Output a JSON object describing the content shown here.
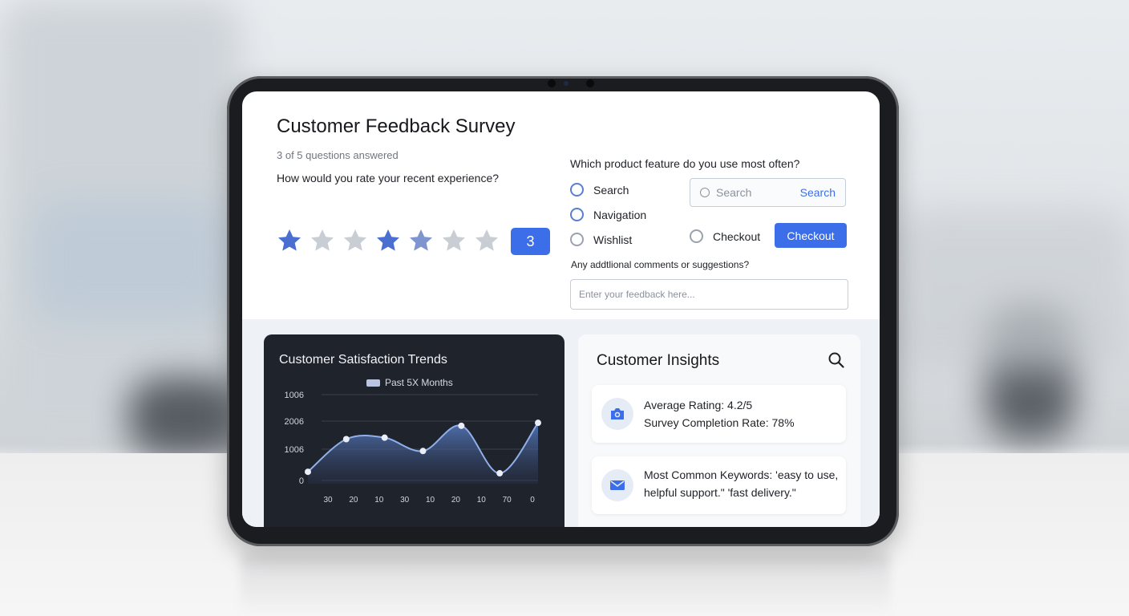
{
  "survey": {
    "title": "Customer Feedback Survey",
    "progress_text": "3 of 5 questions answered",
    "q1": {
      "text": "How would you rate your recent experience?",
      "stars": [
        "filled",
        "empty",
        "empty",
        "filled",
        "half",
        "empty",
        "empty"
      ],
      "selected_value": "3"
    },
    "q2": {
      "text": "Which product feature do you use most often?",
      "options": [
        {
          "label": "Search",
          "state": "unselected"
        },
        {
          "label": "Navigation",
          "state": "unselected"
        },
        {
          "label": "Wishlist",
          "state": "unselected"
        },
        {
          "label": "Checkout",
          "state": "unselected"
        }
      ],
      "search_placeholder": "Search",
      "search_button": "Search",
      "checkout_button": "Checkout"
    },
    "q3": {
      "text": "Any addtlional comments or suggestions?",
      "placeholder": "Enter your feedback here..."
    }
  },
  "trend_chart": {
    "title": "Customer Satisfaction Trends",
    "legend": "Past 5X Months",
    "chart_data": {
      "type": "area",
      "title": "Customer Satisfaction Trends",
      "series": [
        {
          "name": "Past 5X Months",
          "values": [
            400,
            1500,
            1550,
            1100,
            1950,
            350,
            2050
          ]
        }
      ],
      "y_ticks": [
        "1006",
        "2006",
        "1006",
        "0"
      ],
      "x_ticks": [
        "30",
        "20",
        "10",
        "30",
        "10",
        "20",
        "10",
        "70",
        "0"
      ],
      "ylim": [
        0,
        3000
      ],
      "grid": true
    }
  },
  "insights": {
    "title": "Customer Insights",
    "items": [
      {
        "lines": [
          "Average Rating: 4.2/5",
          "Survey Completion Rate: 78%"
        ],
        "icon": "camera-icon"
      },
      {
        "lines": [
          "Most Common Keywords: 'easy to use,",
          "helpful support.\"  'fast delivery.\""
        ],
        "icon": "mail-icon"
      }
    ]
  },
  "colors": {
    "accent": "#3b6ee8",
    "star_filled": "#4a6fd0",
    "star_empty": "#c9cdd4",
    "chart_bg": "#1f232b"
  }
}
